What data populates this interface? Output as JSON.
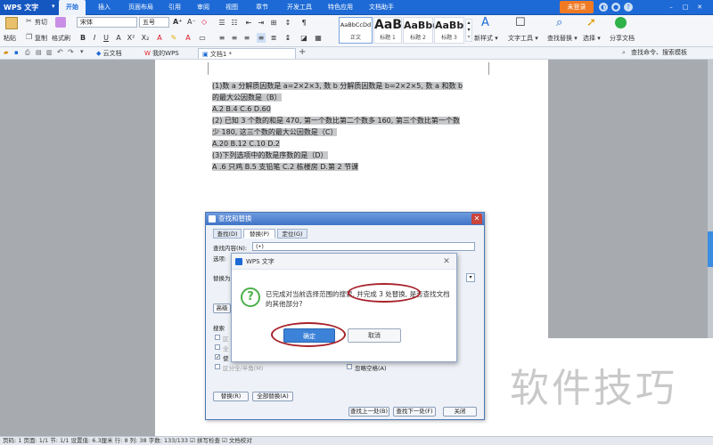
{
  "app": {
    "logo_label": "WPS 文字",
    "login_label": "未登录",
    "tabs": [
      "开始",
      "插入",
      "页面布局",
      "引用",
      "审阅",
      "视图",
      "章节",
      "开发工具",
      "特色应用",
      "文档助手"
    ]
  },
  "ribbon": {
    "cut": "剪切",
    "paste": "粘贴",
    "copy": "复制",
    "format_painter": "格式刷",
    "font_name": "宋体",
    "font_size": "五号",
    "styles": [
      {
        "preview": "AaBbCcDd",
        "name": "正文"
      },
      {
        "preview": "AaB",
        "name": "标题 1"
      },
      {
        "preview": "AaBb(",
        "name": "标题 2"
      },
      {
        "preview": "AaBb",
        "name": "标题 3"
      }
    ],
    "new_style": "新样式 ▾",
    "text_tools": "文字工具 ▾",
    "find_replace": "查找替换 ▾",
    "select": "选择 ▾",
    "share_doc": "分享文档"
  },
  "doc_tabs": {
    "cloud": "云文档",
    "my_wps": "我的WPS",
    "document": "文档1 *",
    "search_placeholder": "查找命令、搜索模板"
  },
  "document": {
    "lines": [
      "(1)数 a 分解质因数是 a=2×2×3, 数 b 分解质因数是 b=2×2×5, 数 a 和数 b",
      "的最大公因数是（B）",
      "A.2  B.4  C.6  D.60",
      "(2) 已知 3 个数的和是 470, 第一个数比第二个数多 160, 第三个数比第一个数",
      "少 180, 这三个数的最大公因数是（C）",
      "A.20  B.12  C.10  D.2",
      "(3)下列选项中的数是序数的是（D）",
      "A .6 只鸡     B.5 支铅笔     C.2 栋楼房     D.第 2 节课"
    ]
  },
  "find_replace_dialog": {
    "title": "查找和替换",
    "tabs": [
      "查找(D)",
      "替换(P)",
      "定位(G)"
    ],
    "find_label": "查找内容(N):",
    "find_value": "(•)",
    "options_label": "选项:",
    "replace_label": "替换为",
    "advanced_label": "高级",
    "search_label": "搜索",
    "check_labels": [
      "区",
      "全",
      "使",
      "区分全/半角(M)"
    ],
    "ignore_space": "忽略空格(A)",
    "replace_btn": "替换(R)",
    "replace_all_btn": "全部替换(A)",
    "find_prev_btn": "查找上一处(B)",
    "find_next_btn": "查找下一处(F)",
    "close_btn": "关闭"
  },
  "message_box": {
    "title": "WPS 文字",
    "text": "已完成对当前选择范围的搜索, 并完成 3 处替换, 是否查找文档的其他部分?",
    "ok": "确定",
    "cancel": "取消"
  },
  "status_bar": {
    "text": "页码: 1  页面: 1/1  节: 1/1  设置值: 6.3厘米  行: 8  列: 38  字数: 133/133  ☑ 拼写检查  ☑ 文档校对"
  },
  "watermark": "软件技巧",
  "colors": {
    "accent": "#1d6ad6",
    "annotation_red": "#a8222a",
    "ok_button": "#3c82d8"
  }
}
